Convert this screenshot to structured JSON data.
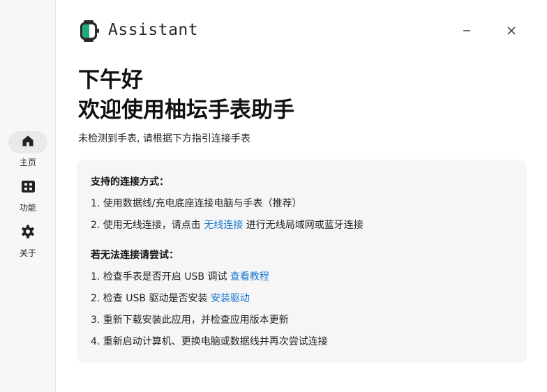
{
  "sidebar": {
    "items": [
      {
        "label": "主页",
        "icon": "home-icon",
        "active": true
      },
      {
        "label": "功能",
        "icon": "grid-icon",
        "active": false
      },
      {
        "label": "关于",
        "icon": "gear-icon",
        "active": false
      }
    ]
  },
  "header": {
    "title": "Assistant",
    "logo_icon": "watch-logo-icon",
    "minimize_icon": "minimize-icon",
    "close_icon": "close-icon"
  },
  "main": {
    "greeting": "下午好",
    "welcome": "欢迎使用柚坛手表助手",
    "status": "未检测到手表, 请根据下方指引连接手表"
  },
  "connect": {
    "heading": "支持的连接方式：",
    "item1": "1. 使用数据线/充电底座连接电脑与手表（推荐）",
    "item2_prefix": "2. 使用无线连接，请点击",
    "item2_link": "无线连接",
    "item2_suffix": "进行无线局域网或蓝牙连接"
  },
  "troubleshoot": {
    "heading": "若无法连接请尝试：",
    "item1_prefix": "1. 检查手表是否开启 USB 调试",
    "item1_link": "查看教程",
    "item2_prefix": "2. 检查 USB 驱动是否安装",
    "item2_link": "安装驱动",
    "item3": "3. 重新下载安装此应用，并检查应用版本更新",
    "item4": "4. 重新启动计算机、更换电脑或数据线并再次尝试连接"
  },
  "colors": {
    "link": "#1877d2",
    "sidebar_bg": "#f7f7f7",
    "card_bg": "#f6f6f6",
    "logo_green": "#1fae7a"
  }
}
